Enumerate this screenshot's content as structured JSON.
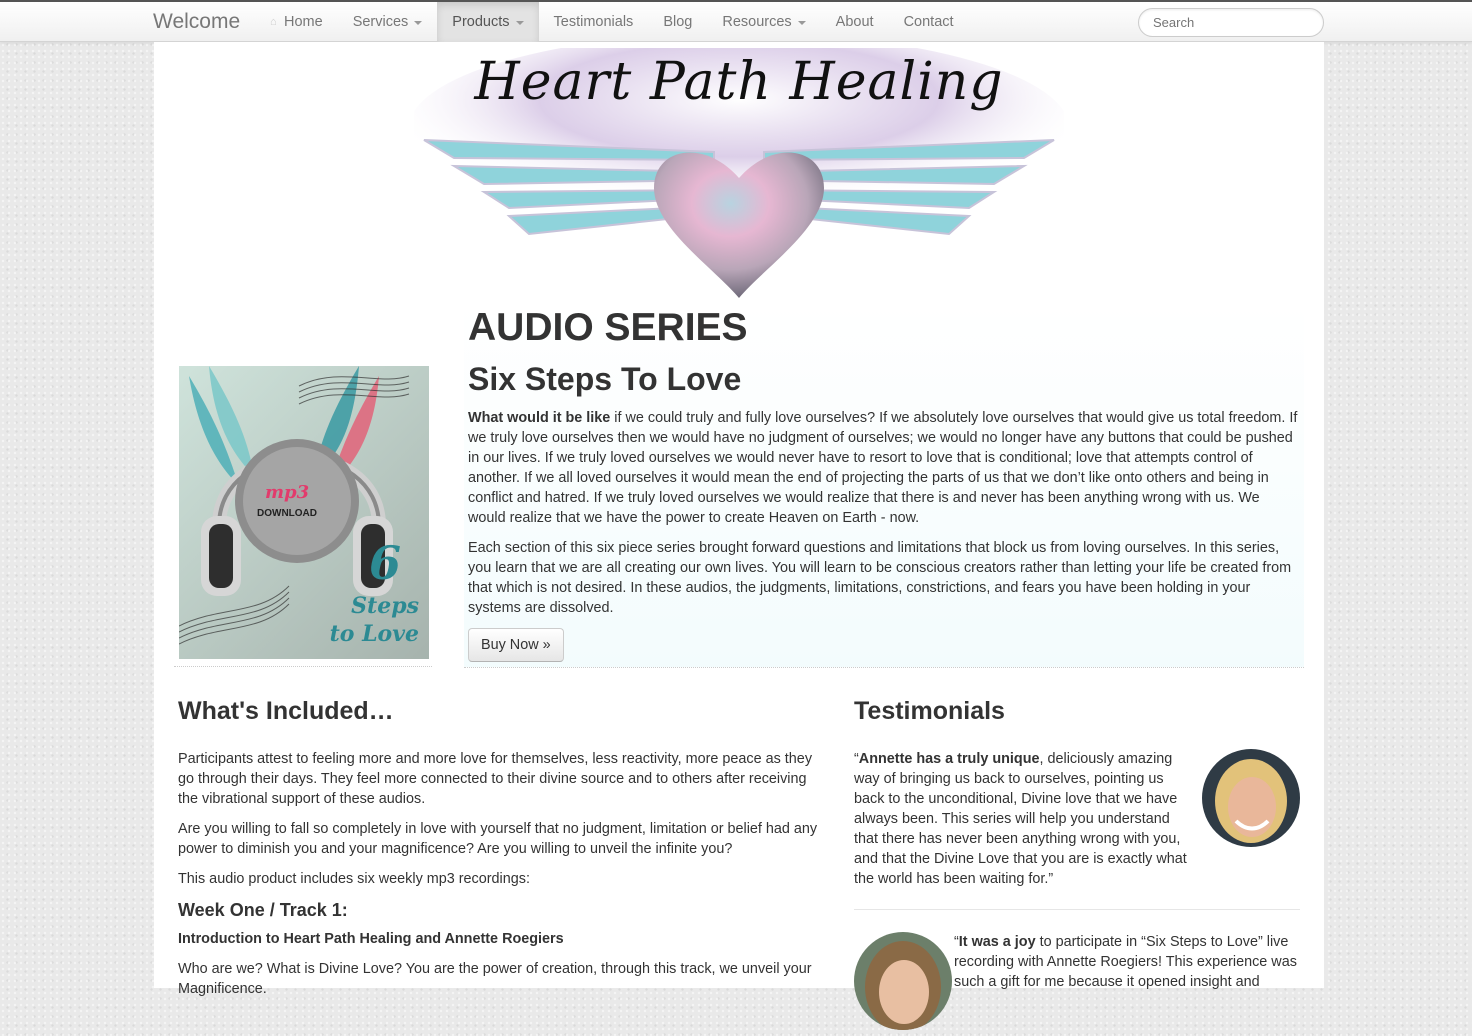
{
  "nav": {
    "brand": "Welcome",
    "items": [
      {
        "label": "Home",
        "icon": "home-icon",
        "dropdown": false,
        "active": false
      },
      {
        "label": "Services",
        "dropdown": true,
        "active": false
      },
      {
        "label": "Products",
        "dropdown": true,
        "active": true
      },
      {
        "label": "Testimonials",
        "dropdown": false,
        "active": false
      },
      {
        "label": "Blog",
        "dropdown": false,
        "active": false
      },
      {
        "label": "Resources",
        "dropdown": true,
        "active": false
      },
      {
        "label": "About",
        "dropdown": false,
        "active": false
      },
      {
        "label": "Contact",
        "dropdown": false,
        "active": false
      }
    ],
    "search_placeholder": "Search"
  },
  "logo": {
    "text": "Heart Path Healing"
  },
  "cover": {
    "badge_line1": "mp3",
    "badge_line2": "DOWNLOAD",
    "number": "6",
    "steps_line1": "Steps",
    "steps_line2": "to Love"
  },
  "series": {
    "title": "AUDIO SERIES",
    "subtitle": "Six Steps To Love",
    "p1_lead": "What would it be like",
    "p1_rest": " if we could truly and fully love ourselves? If we absolutely love ourselves that would give us total freedom. If we truly love ourselves then we would have no judgment of ourselves; we would no longer have any buttons that could be pushed in our lives. If we truly loved ourselves we would never have to resort to love that is conditional; love that attempts control of another. If we all loved ourselves it would mean the end of projecting the parts of us that we don’t like onto others and being in conflict and hatred. If we truly loved ourselves we would realize that there is and never has been anything wrong with us. We would realize that we have the power to create Heaven on Earth - now.",
    "p2": "Each section of this six piece series brought forward questions and limitations that block us from loving ourselves. In this series, you learn that we are all creating our own lives. You will learn to be conscious creators rather than letting your life be created from that which is not desired. In these audios, the judgments, limitations, constrictions, and fears you have been holding in your systems are dissolved.",
    "buy_label": "Buy Now »"
  },
  "included": {
    "heading": "What's Included…",
    "p1": "Participants attest to feeling more and more love for themselves, less reactivity, more peace as they go through their days. They feel more connected to their divine source and to others after receiving the vibrational support of these audios.",
    "p2": "Are you willing to fall so completely in love with yourself that no judgment, limitation or belief had any power to diminish you and your magnificence? Are you willing to unveil the infinite you?",
    "p3": "This audio product includes six weekly mp3 recordings:",
    "week_title": "Week One / Track 1:",
    "week_sub": "Introduction to Heart Path Healing and Annette Roegiers",
    "week_text": "Who are we? What is Divine Love? You are the power of creation, through this track, we unveil your Magnificence."
  },
  "testimonials": {
    "heading": "Testimonials",
    "t1_open": "“",
    "t1_lead": "Annette has a truly unique",
    "t1_rest": ", deliciously amazing way of bringing us back to ourselves, pointing us back to the unconditional, Divine love that we have always been. This series will help you understand that there has never been anything wrong with you, and that the Divine Love that you are is exactly what the world has been waiting for.”",
    "t2_open": "“",
    "t2_lead": "It was a joy",
    "t2_rest": " to participate in “Six Steps to Love” live recording with Annette Roegiers! This experience was such a gift for me because it opened insight and"
  }
}
